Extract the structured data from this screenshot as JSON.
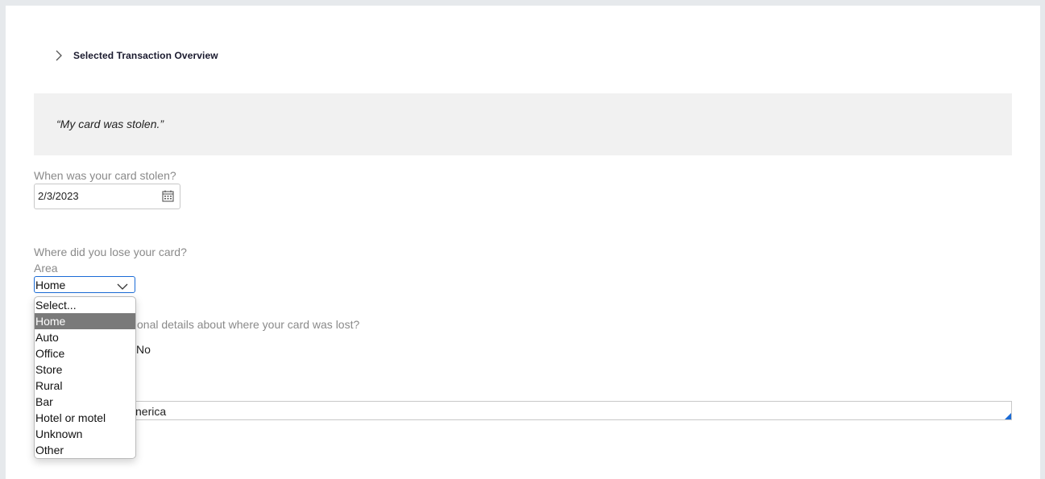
{
  "overview": {
    "title": "Selected Transaction Overview",
    "icon": "chevron-right-icon"
  },
  "quote": {
    "text": "“My card was stolen.”"
  },
  "stolen_date": {
    "label": "When was your card stolen?",
    "value": "2/3/2023",
    "icon": "calendar-icon"
  },
  "loss_location": {
    "question": "Where did you lose your card?",
    "area_label": "Area",
    "selected": "Home",
    "options": [
      "Select...",
      "Home",
      "Auto",
      "Office",
      "Store",
      "Rural",
      "Bar",
      "Hotel or motel",
      "Unknown",
      "Other"
    ]
  },
  "details": {
    "question_visible": "onal details about where your card was lost?",
    "radio_no_label": "No"
  },
  "country_field": {
    "value_visible": "nerica"
  },
  "colors": {
    "accent": "#1a6bd6",
    "quote_bg": "#f1f1f1",
    "selected_option_bg": "#7a7a7a",
    "page_bg": "#e6e9ec"
  }
}
